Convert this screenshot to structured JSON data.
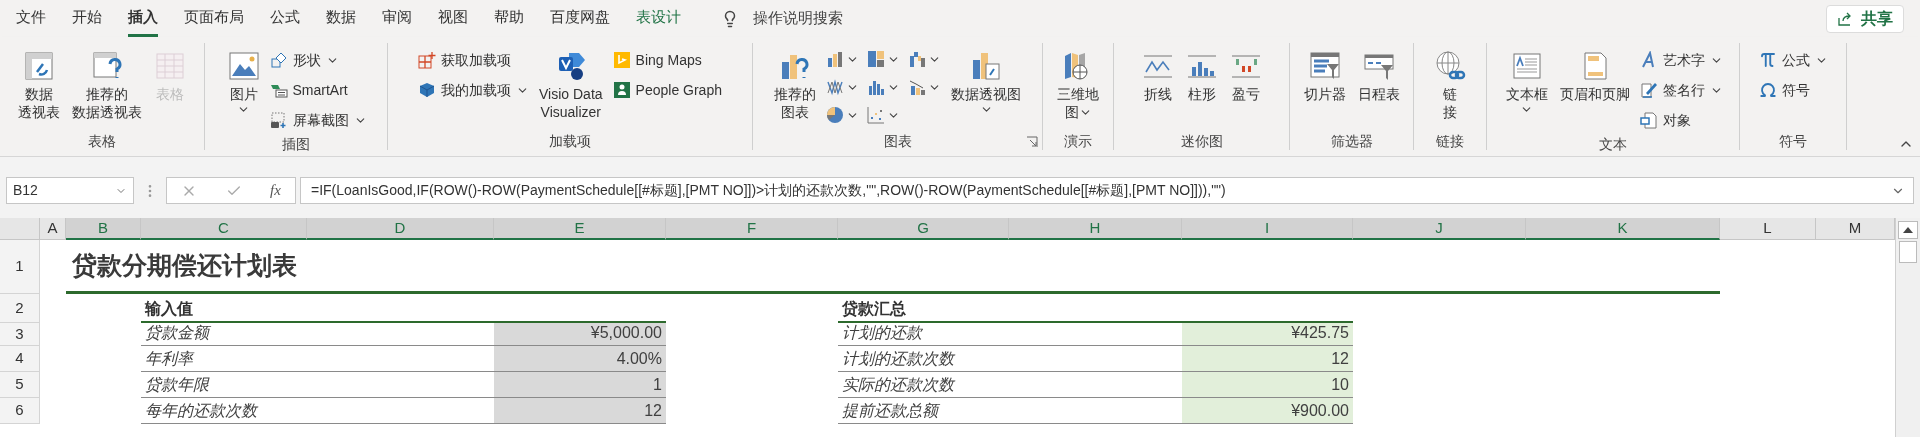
{
  "menu_tabs": [
    {
      "label": "文件",
      "kind": "tab",
      "selected": false
    },
    {
      "label": "开始",
      "kind": "tab",
      "selected": false
    },
    {
      "label": "插入",
      "kind": "tab",
      "selected": true
    },
    {
      "label": "页面布局",
      "kind": "tab",
      "selected": false
    },
    {
      "label": "公式",
      "kind": "tab",
      "selected": false
    },
    {
      "label": "数据",
      "kind": "tab",
      "selected": false
    },
    {
      "label": "审阅",
      "kind": "tab",
      "selected": false
    },
    {
      "label": "视图",
      "kind": "tab",
      "selected": false
    },
    {
      "label": "帮助",
      "kind": "tab",
      "selected": false
    },
    {
      "label": "百度网盘",
      "kind": "tab",
      "selected": false
    },
    {
      "label": "表设计",
      "kind": "contextual",
      "selected": false
    }
  ],
  "search": {
    "label": "操作说明搜索"
  },
  "share": {
    "label": "共享"
  },
  "ribbon_groups": [
    {
      "label": "表格",
      "launcher": false,
      "items": [
        {
          "kind": "large",
          "lines": [
            "数据",
            "透视表"
          ],
          "dropdown": false,
          "disabled": false
        },
        {
          "kind": "large",
          "lines": [
            "推荐的",
            "数据透视表"
          ],
          "dropdown": false,
          "disabled": false
        },
        {
          "kind": "large",
          "lines": [
            "表格"
          ],
          "dropdown": false,
          "disabled": true
        }
      ]
    },
    {
      "label": "插图",
      "launcher": false,
      "items": [
        {
          "kind": "large",
          "lines": [
            "图片"
          ],
          "dropdown": true,
          "disabled": false
        },
        {
          "kind": "stack",
          "items": [
            {
              "kind": "small",
              "label": "形状",
              "dropdown": true
            },
            {
              "kind": "small",
              "label": "SmartArt",
              "dropdown": false
            },
            {
              "kind": "small",
              "label": "屏幕截图",
              "dropdown": true
            }
          ]
        }
      ]
    },
    {
      "label": "加载项",
      "launcher": false,
      "items": [
        {
          "kind": "stack",
          "items": [
            {
              "kind": "small",
              "label": "获取加载项",
              "dropdown": false
            },
            {
              "kind": "small",
              "label": "我的加载项",
              "dropdown": true
            }
          ]
        },
        {
          "kind": "large",
          "lines": [
            "Visio Data",
            "Visualizer"
          ],
          "dropdown": false,
          "disabled": false
        },
        {
          "kind": "stack",
          "items": [
            {
              "kind": "small",
              "label": "Bing Maps",
              "dropdown": false
            },
            {
              "kind": "small",
              "label": "People Graph",
              "dropdown": false
            }
          ]
        }
      ]
    },
    {
      "label": "图表",
      "launcher": true,
      "items": [
        {
          "kind": "large",
          "lines": [
            "推荐的",
            "图表"
          ],
          "dropdown": false,
          "disabled": false
        },
        {
          "kind": "stack",
          "items": [
            {
              "kind": "icon",
              "dropdown": true
            },
            {
              "kind": "icon",
              "dropdown": true
            },
            {
              "kind": "icon",
              "dropdown": true
            }
          ]
        },
        {
          "kind": "stack",
          "items": [
            {
              "kind": "icon",
              "dropdown": true
            },
            {
              "kind": "icon",
              "dropdown": true
            },
            {
              "kind": "icon",
              "dropdown": true
            }
          ]
        },
        {
          "kind": "stack",
          "items": [
            {
              "kind": "icon",
              "dropdown": true
            },
            {
              "kind": "icon",
              "dropdown": true
            }
          ]
        },
        {
          "kind": "large",
          "lines": [
            "数据透视图"
          ],
          "dropdown": true,
          "disabled": false
        }
      ]
    },
    {
      "label": "演示",
      "launcher": false,
      "items": [
        {
          "kind": "large",
          "lines": [
            "三维地",
            "图"
          ],
          "dropdown": true,
          "disabled": false
        }
      ]
    },
    {
      "label": "迷你图",
      "launcher": false,
      "items": [
        {
          "kind": "large",
          "lines": [
            "折线"
          ],
          "dropdown": false,
          "disabled": false
        },
        {
          "kind": "large",
          "lines": [
            "柱形"
          ],
          "dropdown": false,
          "disabled": false
        },
        {
          "kind": "large",
          "lines": [
            "盈亏"
          ],
          "dropdown": false,
          "disabled": false
        }
      ]
    },
    {
      "label": "筛选器",
      "launcher": false,
      "items": [
        {
          "kind": "large",
          "lines": [
            "切片器"
          ],
          "dropdown": false,
          "disabled": false
        },
        {
          "kind": "large",
          "lines": [
            "日程表"
          ],
          "dropdown": false,
          "disabled": false
        }
      ]
    },
    {
      "label": "链接",
      "launcher": false,
      "items": [
        {
          "kind": "large",
          "lines": [
            "链",
            "接"
          ],
          "dropdown": false,
          "disabled": false
        }
      ]
    },
    {
      "label": "文本",
      "launcher": false,
      "items": [
        {
          "kind": "large",
          "lines": [
            "文本框"
          ],
          "dropdown": true,
          "disabled": false
        },
        {
          "kind": "large",
          "lines": [
            "页眉和页脚"
          ],
          "dropdown": false,
          "disabled": false
        },
        {
          "kind": "stack",
          "items": [
            {
              "kind": "small",
              "label": "艺术字",
              "dropdown": true
            },
            {
              "kind": "small",
              "label": "签名行",
              "dropdown": true
            },
            {
              "kind": "small",
              "label": "对象",
              "dropdown": false
            }
          ]
        }
      ]
    },
    {
      "label": "符号",
      "launcher": false,
      "items": [
        {
          "kind": "stack",
          "items": [
            {
              "kind": "small",
              "label": "公式",
              "dropdown": true
            },
            {
              "kind": "small",
              "label": "符号",
              "dropdown": false
            }
          ]
        }
      ]
    }
  ],
  "formula_bar": {
    "name_box": "B12",
    "function_label": "fx",
    "formula": "=IF(LoanIsGood,IF(ROW()-ROW(PaymentSchedule[[#标题],[PMT NO]])>计划的还款次数,\"\",ROW()-ROW(PaymentSchedule[[#标题],[PMT NO]])),\"\")"
  },
  "sheet": {
    "columns": [
      {
        "label": "A",
        "selected": false
      },
      {
        "label": "B",
        "selected": true
      },
      {
        "label": "C",
        "selected": true
      },
      {
        "label": "D",
        "selected": true
      },
      {
        "label": "E",
        "selected": true
      },
      {
        "label": "F",
        "selected": true
      },
      {
        "label": "G",
        "selected": true
      },
      {
        "label": "H",
        "selected": true
      },
      {
        "label": "I",
        "selected": true
      },
      {
        "label": "J",
        "selected": true
      },
      {
        "label": "K",
        "selected": true
      },
      {
        "label": "L",
        "selected": false
      },
      {
        "label": "M",
        "selected": false
      }
    ],
    "row_headers": [
      "1",
      "2",
      "3",
      "4",
      "5",
      "6"
    ],
    "title": "贷款分期偿还计划表",
    "sections": [
      {
        "heading": "输入值",
        "kind": "input",
        "rows": [
          {
            "label": "贷款金额",
            "value": "¥5,000.00"
          },
          {
            "label": "年利率",
            "value": "4.00%"
          },
          {
            "label": "贷款年限",
            "value": "1"
          },
          {
            "label": "每年的还款次数",
            "value": "12"
          }
        ]
      },
      {
        "heading": "贷款汇总",
        "kind": "summary",
        "rows": [
          {
            "label": "计划的还款",
            "value": "¥425.75"
          },
          {
            "label": "计划的还款次数",
            "value": "12"
          },
          {
            "label": "实际的还款次数",
            "value": "10"
          },
          {
            "label": "提前还款总额",
            "value": "¥900.00"
          }
        ]
      }
    ]
  }
}
